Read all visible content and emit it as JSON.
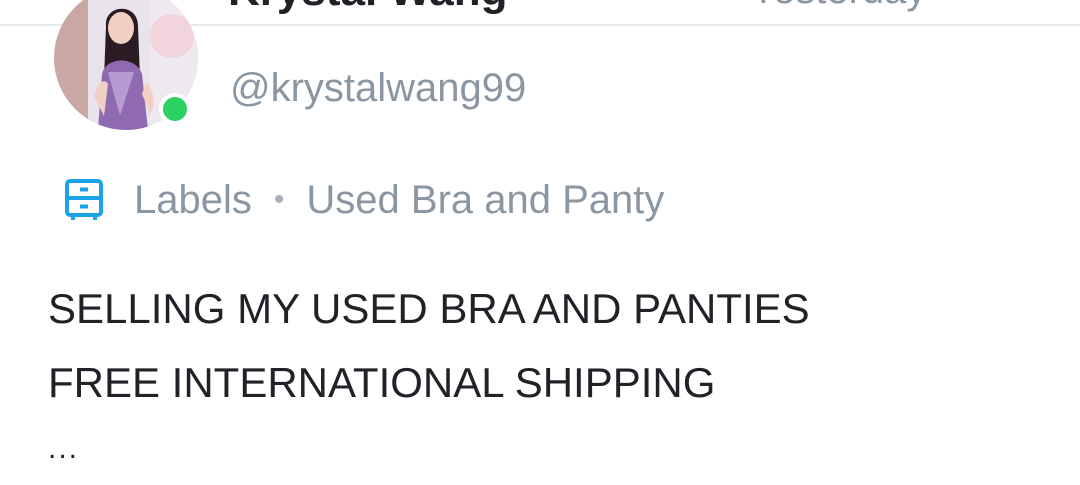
{
  "header": {
    "display_name": "Krystal Wang",
    "timestamp": "Yesterday"
  },
  "author": {
    "handle": "@krystalwang99",
    "online": true,
    "online_color": "#2bd163"
  },
  "labels": {
    "icon": "drawer-icon",
    "icon_color": "#1aa3e8",
    "title": "Labels",
    "separator": "•",
    "value": "Used Bra and Panty"
  },
  "post": {
    "lines": [
      "SELLING MY USED BRA AND PANTIES",
      "FREE INTERNATIONAL SHIPPING"
    ],
    "ellipsis": "..."
  }
}
